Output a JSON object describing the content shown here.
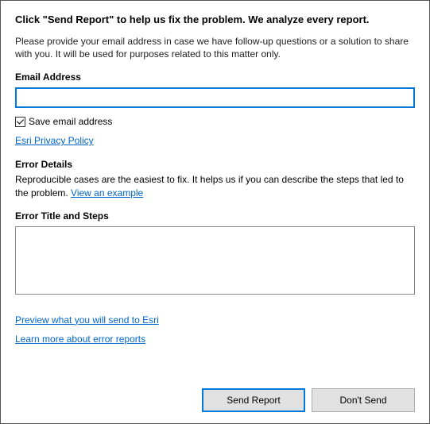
{
  "heading": "Click \"Send Report\" to help us fix the problem. We analyze every report.",
  "intro": "Please provide your email address in case we have follow-up questions or a solution to share with you. It will be used for purposes related to this matter only.",
  "email": {
    "label": "Email Address",
    "value": ""
  },
  "saveEmail": {
    "checked": true,
    "label": "Save email address"
  },
  "privacyLink": "Esri Privacy Policy",
  "errorDetails": {
    "label": "Error Details",
    "intro_prefix": "Reproducible cases are the easiest to fix. It helps us if you can describe the steps that led to the problem. ",
    "exampleLink": "View an example"
  },
  "errorTitle": {
    "label": "Error Title and Steps",
    "value": ""
  },
  "links": {
    "preview": "Preview what you will send to Esri",
    "learnMore": "Learn more about error reports"
  },
  "buttons": {
    "send": "Send Report",
    "dontSend": "Don't Send"
  }
}
